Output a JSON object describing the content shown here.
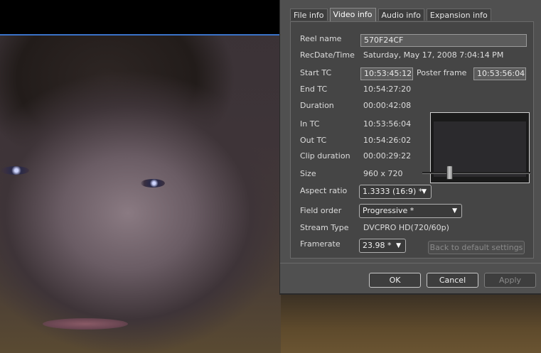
{
  "tabs": [
    "File info",
    "Video info",
    "Audio info",
    "Expansion info"
  ],
  "active_tab": 1,
  "fields": {
    "reel_name": {
      "label": "Reel name",
      "value": "570F24CF"
    },
    "recdate": {
      "label": "RecDate/Time",
      "value": "Saturday, May 17, 2008 7:04:14 PM"
    },
    "start_tc": {
      "label": "Start TC",
      "value": "10:53:45:12"
    },
    "poster_frame": {
      "label": "Poster frame",
      "value": "10:53:56:04"
    },
    "end_tc": {
      "label": "End TC",
      "value": "10:54:27:20"
    },
    "duration": {
      "label": "Duration",
      "value": "00:00:42:08"
    },
    "in_tc": {
      "label": "In TC",
      "value": "10:53:56:04"
    },
    "out_tc": {
      "label": "Out TC",
      "value": "10:54:26:02"
    },
    "clip_duration": {
      "label": "Clip duration",
      "value": "00:00:29:22"
    },
    "size": {
      "label": "Size",
      "value": "960 x 720"
    },
    "aspect_ratio": {
      "label": "Aspect ratio",
      "value": "1.3333 (16:9) *"
    },
    "field_order": {
      "label": "Field order",
      "value": "Progressive *"
    },
    "stream_type": {
      "label": "Stream Type",
      "value": "DVCPRO HD(720/60p)"
    },
    "framerate": {
      "label": "Framerate",
      "value": "23.98 *"
    }
  },
  "buttons": {
    "default_settings": "Back to default settings",
    "ok": "OK",
    "cancel": "Cancel",
    "apply": "Apply"
  },
  "poster_slider_position": 0.25
}
